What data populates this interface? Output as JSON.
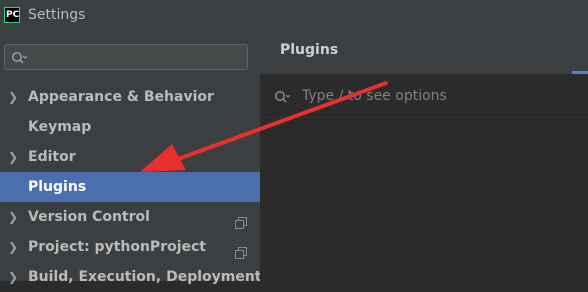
{
  "window": {
    "title": "Settings",
    "app_icon_text": "PC"
  },
  "sidebar": {
    "search_placeholder": "",
    "items": [
      {
        "label": "Appearance & Behavior",
        "expandable": true
      },
      {
        "label": "Keymap",
        "expandable": false
      },
      {
        "label": "Editor",
        "expandable": true
      },
      {
        "label": "Plugins",
        "expandable": false,
        "selected": true
      },
      {
        "label": "Version Control",
        "expandable": true,
        "project_icon": true
      },
      {
        "label": "Project: pythonProject",
        "expandable": true,
        "project_icon": true
      },
      {
        "label": "Build, Execution, Deployment",
        "expandable": true
      }
    ]
  },
  "content": {
    "title": "Plugins",
    "search_placeholder": "Type / to see options"
  },
  "colors": {
    "selection": "#4b6eaf",
    "annotation_arrow": "#e8302c",
    "accent": "#4a88c7"
  },
  "icons": {
    "search": "search-icon",
    "chevron": "chevron-right-icon",
    "copy": "copy-icon"
  }
}
